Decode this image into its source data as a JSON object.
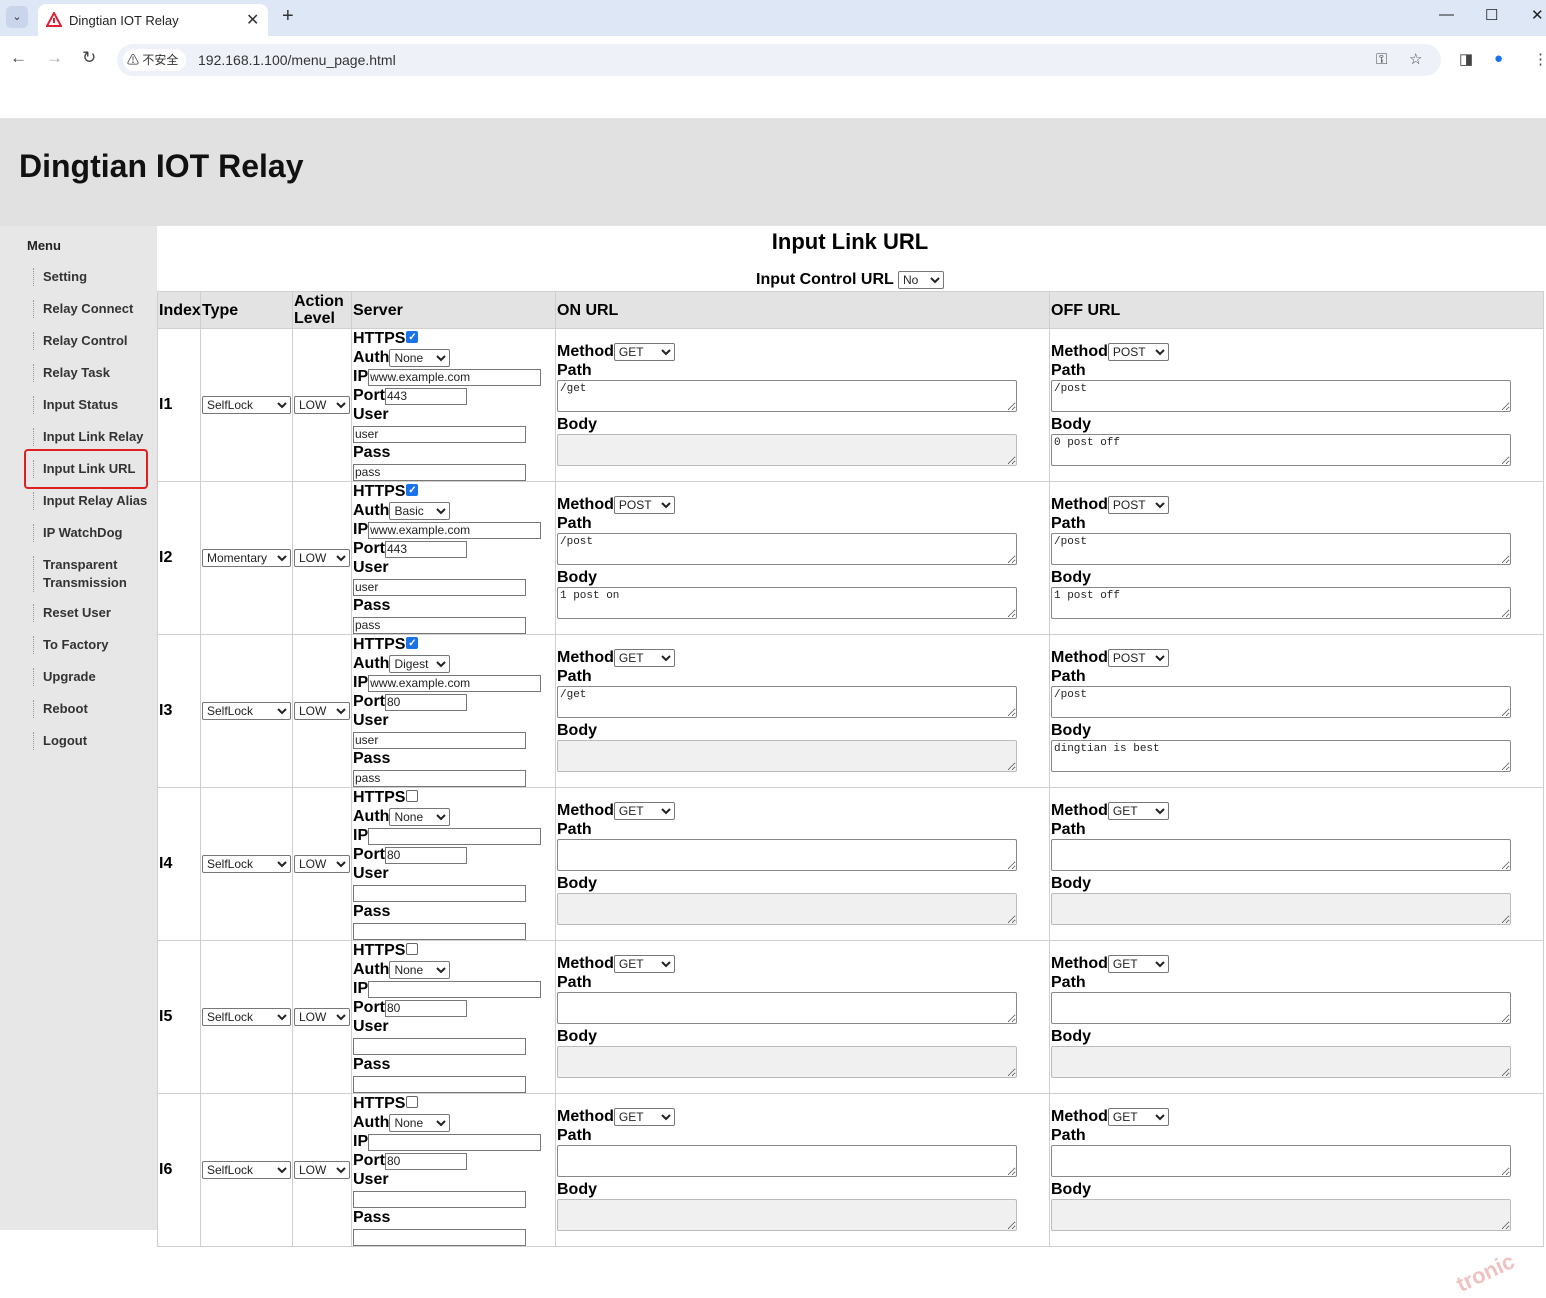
{
  "browser": {
    "tab_title": "Dingtian IOT Relay",
    "security_label": "不安全",
    "url": "192.168.1.100/menu_page.html"
  },
  "site": {
    "title": "Dingtian IOT Relay"
  },
  "menu": {
    "title": "Menu",
    "items": [
      {
        "label": "Setting"
      },
      {
        "label": "Relay Connect"
      },
      {
        "label": "Relay Control"
      },
      {
        "label": "Relay Task"
      },
      {
        "label": "Input Status"
      },
      {
        "label": "Input Link Relay"
      },
      {
        "label": "Input Link URL",
        "active": true
      },
      {
        "label": "Input Relay Alias"
      },
      {
        "label": "IP WatchDog"
      },
      {
        "label": "Transparent Transmission"
      },
      {
        "label": "Reset User"
      },
      {
        "label": "To Factory"
      },
      {
        "label": "Upgrade"
      },
      {
        "label": "Reboot"
      },
      {
        "label": "Logout"
      }
    ]
  },
  "main": {
    "heading": "Input Link URL",
    "input_control_url_label": "Input Control URL",
    "input_control_url_value": "No",
    "columns": [
      "Index",
      "Type",
      "Action Level",
      "Server",
      "ON URL",
      "OFF URL"
    ],
    "field_labels": {
      "https": "HTTPS",
      "auth": "Auth",
      "ip": "IP",
      "port": "Port",
      "user": "User",
      "pass": "Pass",
      "method": "Method",
      "path": "Path",
      "body": "Body"
    },
    "rows": [
      {
        "index": "I1",
        "type": "SelfLock",
        "level": "LOW",
        "https": true,
        "auth": "None",
        "ip": "www.example.com",
        "port": "443",
        "user": "user",
        "pass": "pass",
        "on": {
          "method": "GET",
          "path": "/get",
          "body": ""
        },
        "off": {
          "method": "POST",
          "path": "/post",
          "body": "0 post off"
        }
      },
      {
        "index": "I2",
        "type": "Momentary",
        "level": "LOW",
        "https": true,
        "auth": "Basic",
        "ip": "www.example.com",
        "port": "443",
        "user": "user",
        "pass": "pass",
        "on": {
          "method": "POST",
          "path": "/post",
          "body": "1 post on"
        },
        "off": {
          "method": "POST",
          "path": "/post",
          "body": "1 post off"
        }
      },
      {
        "index": "I3",
        "type": "SelfLock",
        "level": "LOW",
        "https": true,
        "auth": "Digest",
        "ip": "www.example.com",
        "port": "80",
        "user": "user",
        "pass": "pass",
        "on": {
          "method": "GET",
          "path": "/get",
          "body": ""
        },
        "off": {
          "method": "POST",
          "path": "/post",
          "body": "dingtian is best"
        }
      },
      {
        "index": "I4",
        "type": "SelfLock",
        "level": "LOW",
        "https": false,
        "auth": "None",
        "ip": "",
        "port": "80",
        "user": "",
        "pass": "",
        "on": {
          "method": "GET",
          "path": "",
          "body": ""
        },
        "off": {
          "method": "GET",
          "path": "",
          "body": ""
        }
      },
      {
        "index": "I5",
        "type": "SelfLock",
        "level": "LOW",
        "https": false,
        "auth": "None",
        "ip": "",
        "port": "80",
        "user": "",
        "pass": "",
        "on": {
          "method": "GET",
          "path": "",
          "body": ""
        },
        "off": {
          "method": "GET",
          "path": "",
          "body": ""
        }
      },
      {
        "index": "I6",
        "type": "SelfLock",
        "level": "LOW",
        "https": false,
        "auth": "None",
        "ip": "",
        "port": "80",
        "user": "",
        "pass": "",
        "on": {
          "method": "GET",
          "path": "",
          "body": ""
        },
        "off": {
          "method": "GET",
          "path": "",
          "body": ""
        }
      }
    ]
  },
  "watermark": "tronic"
}
